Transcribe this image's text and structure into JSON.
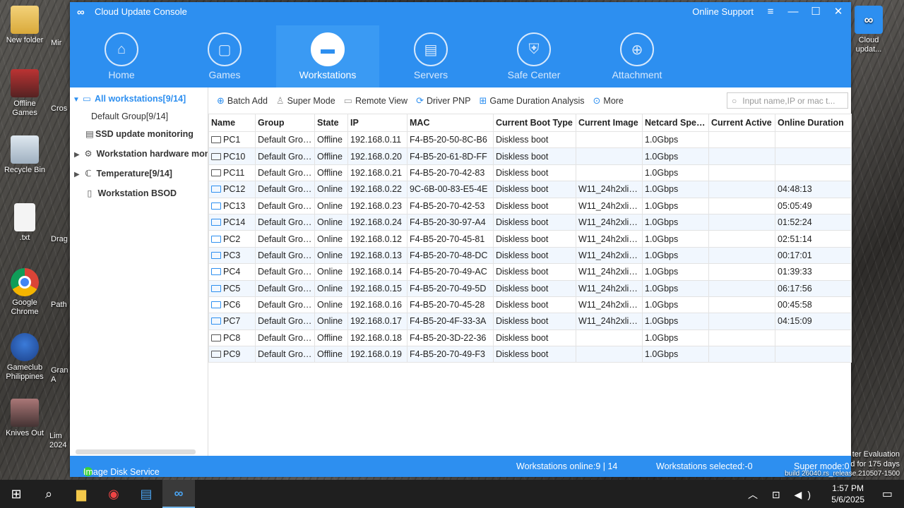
{
  "desktop": {
    "icons": [
      {
        "label": "New folder"
      },
      {
        "label": "Mir"
      },
      {
        "label": "Offline Games"
      },
      {
        "label": "Cros"
      },
      {
        "label": "Recycle Bin"
      },
      {
        "label": ".txt"
      },
      {
        "label": "Drag"
      },
      {
        "label": "Google Chrome"
      },
      {
        "label": "Path"
      },
      {
        "label": "Gameclub Philippines"
      },
      {
        "label": "Gran A"
      },
      {
        "label": "Knives Out"
      },
      {
        "label": "Lim 2024"
      },
      {
        "label": "Cloud updat..."
      }
    ],
    "watermark_line1": "ter Evaluation",
    "watermark_line2": "d for 175 days",
    "watermark_line3": "build 26040.rs_release.210507-1500"
  },
  "window": {
    "title": "Cloud Update Console",
    "logo": "∞",
    "online_support": "Online Support",
    "menu_icon": "≡",
    "minimize_icon": "—",
    "maximize_icon": "☐",
    "close_icon": "✕"
  },
  "nav": [
    {
      "label": "Home",
      "icon": "⌂"
    },
    {
      "label": "Games",
      "icon": "▢"
    },
    {
      "label": "Workstations",
      "icon": "▬"
    },
    {
      "label": "Servers",
      "icon": "▤"
    },
    {
      "label": "Safe Center",
      "icon": "⛨"
    },
    {
      "label": "Attachment",
      "icon": "⊕"
    }
  ],
  "tree": {
    "all": "All workstations[9/14]",
    "default_group": "Default Group[9/14]",
    "ssd": "SSD update monitoring",
    "hardware": "Workstation hardware mon",
    "temperature": "Temperature[9/14]",
    "bsod": "Workstation BSOD"
  },
  "toolbar": {
    "batch_add": "Batch Add",
    "super_mode": "Super Mode",
    "remote_view": "Remote View",
    "driver_pnp": "Driver PNP",
    "game_duration": "Game Duration Analysis",
    "more": "More",
    "search_placeholder": "Input name,IP or mac t..."
  },
  "table": {
    "headers": [
      "Name",
      "Group",
      "State",
      "IP",
      "MAC",
      "Current Boot Type",
      "Current Image",
      "Netcard Speed",
      "Current Active",
      "Online Duration"
    ],
    "rows": [
      {
        "name": "PC1",
        "group": "Default Group",
        "state": "Offline",
        "ip": "192.168.0.11",
        "mac": "F4-B5-20-50-8C-B6",
        "boot": "Diskless boot",
        "image": "",
        "speed": "1.0Gbps",
        "active": "",
        "duration": ""
      },
      {
        "name": "PC10",
        "group": "Default Group",
        "state": "Offline",
        "ip": "192.168.0.20",
        "mac": "F4-B5-20-61-8D-FF",
        "boot": "Diskless boot",
        "image": "",
        "speed": "1.0Gbps",
        "active": "",
        "duration": ""
      },
      {
        "name": "PC11",
        "group": "Default Group",
        "state": "Offline",
        "ip": "192.168.0.21",
        "mac": "F4-B5-20-70-42-83",
        "boot": "Diskless boot",
        "image": "",
        "speed": "1.0Gbps",
        "active": "",
        "duration": ""
      },
      {
        "name": "PC12",
        "group": "Default Group",
        "state": "Online",
        "ip": "192.168.0.22",
        "mac": "9C-6B-00-83-E5-4E",
        "boot": "Diskless boot",
        "image": "W11_24h2xlite,...",
        "speed": "1.0Gbps",
        "active": "",
        "duration": "04:48:13"
      },
      {
        "name": "PC13",
        "group": "Default Group",
        "state": "Online",
        "ip": "192.168.0.23",
        "mac": "F4-B5-20-70-42-53",
        "boot": "Diskless boot",
        "image": "W11_24h2xlite...",
        "speed": "1.0Gbps",
        "active": "",
        "duration": "05:05:49"
      },
      {
        "name": "PC14",
        "group": "Default Group",
        "state": "Online",
        "ip": "192.168.0.24",
        "mac": "F4-B5-20-30-97-A4",
        "boot": "Diskless boot",
        "image": "W11_24h2xlite...",
        "speed": "1.0Gbps",
        "active": "",
        "duration": "01:52:24"
      },
      {
        "name": "PC2",
        "group": "Default Group",
        "state": "Online",
        "ip": "192.168.0.12",
        "mac": "F4-B5-20-70-45-81",
        "boot": "Diskless boot",
        "image": "W11_24h2xlite...",
        "speed": "1.0Gbps",
        "active": "",
        "duration": "02:51:14"
      },
      {
        "name": "PC3",
        "group": "Default Group",
        "state": "Online",
        "ip": "192.168.0.13",
        "mac": "F4-B5-20-70-48-DC",
        "boot": "Diskless boot",
        "image": "W11_24h2xlite...",
        "speed": "1.0Gbps",
        "active": "",
        "duration": "00:17:01"
      },
      {
        "name": "PC4",
        "group": "Default Group",
        "state": "Online",
        "ip": "192.168.0.14",
        "mac": "F4-B5-20-70-49-AC",
        "boot": "Diskless boot",
        "image": "W11_24h2xlite...",
        "speed": "1.0Gbps",
        "active": "",
        "duration": "01:39:33"
      },
      {
        "name": "PC5",
        "group": "Default Group",
        "state": "Online",
        "ip": "192.168.0.15",
        "mac": "F4-B5-20-70-49-5D",
        "boot": "Diskless boot",
        "image": "W11_24h2xlite...",
        "speed": "1.0Gbps",
        "active": "",
        "duration": "06:17:56"
      },
      {
        "name": "PC6",
        "group": "Default Group",
        "state": "Online",
        "ip": "192.168.0.16",
        "mac": "F4-B5-20-70-45-28",
        "boot": "Diskless boot",
        "image": "W11_24h2xlite...",
        "speed": "1.0Gbps",
        "active": "",
        "duration": "00:45:58"
      },
      {
        "name": "PC7",
        "group": "Default Group",
        "state": "Online",
        "ip": "192.168.0.17",
        "mac": "F4-B5-20-4F-33-3A",
        "boot": "Diskless boot",
        "image": "W11_24h2xlite...",
        "speed": "1.0Gbps",
        "active": "",
        "duration": "04:15:09"
      },
      {
        "name": "PC8",
        "group": "Default Group",
        "state": "Offline",
        "ip": "192.168.0.18",
        "mac": "F4-B5-20-3D-22-36",
        "boot": "Diskless boot",
        "image": "",
        "speed": "1.0Gbps",
        "active": "",
        "duration": ""
      },
      {
        "name": "PC9",
        "group": "Default Group",
        "state": "Offline",
        "ip": "192.168.0.19",
        "mac": "F4-B5-20-70-49-F3",
        "boot": "Diskless boot",
        "image": "",
        "speed": "1.0Gbps",
        "active": "",
        "duration": ""
      }
    ]
  },
  "status": {
    "service": "Image Disk Service",
    "online": "Workstations online:9 | 14",
    "selected": "Workstations selected:-0",
    "super_mode": "Super mode:0"
  },
  "taskbar": {
    "time": "1:57 PM",
    "date": "5/6/2025",
    "tray": "︿ ⊡ ◀)"
  },
  "colors": {
    "accent": "#2d8ff0",
    "row_alt": "#f1f7fe",
    "online_dot": "#3ad33a"
  }
}
